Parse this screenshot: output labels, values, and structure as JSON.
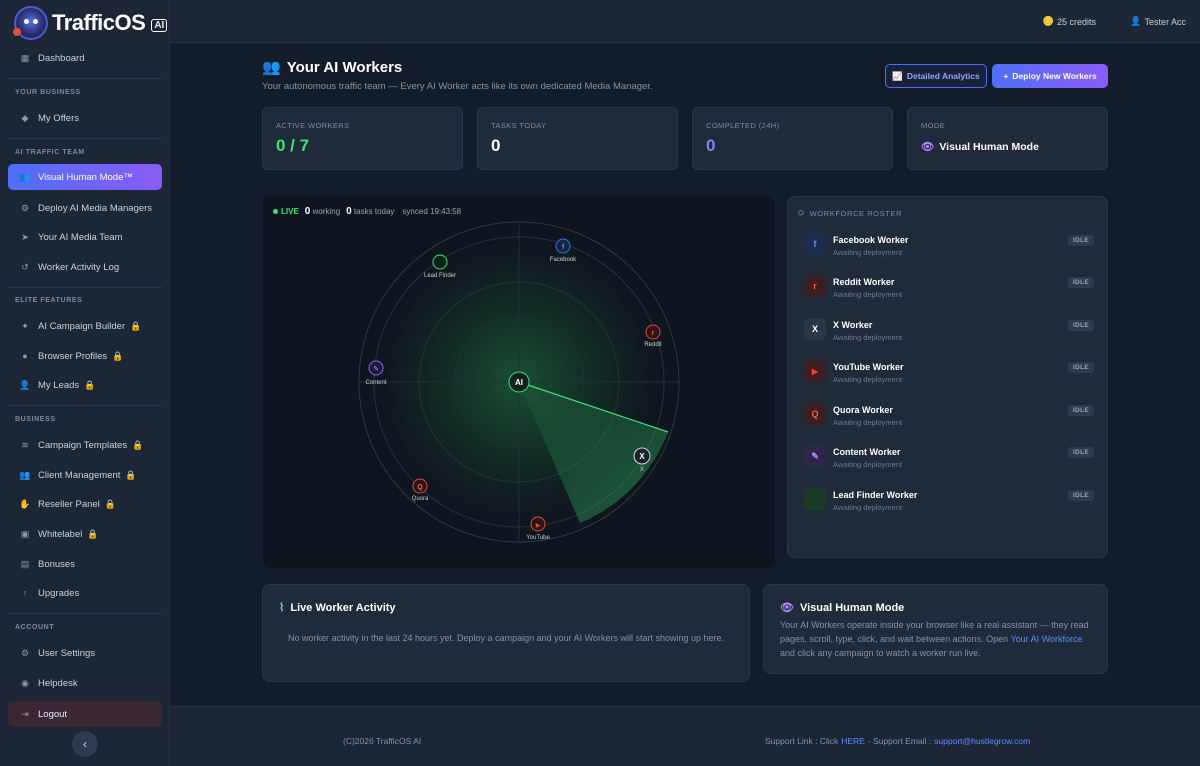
{
  "brand": {
    "name": "TrafficOS",
    "badge": "AI"
  },
  "topbar": {
    "credits": "25 credits",
    "user": "Tester Acc"
  },
  "sidebar": {
    "dashboard": "Dashboard",
    "sec_business": "YOUR BUSINESS",
    "my_offers": "My Offers",
    "sec_traffic": "AI TRAFFIC TEAM",
    "visual_human": "Visual Human Mode™",
    "deploy_managers": "Deploy AI Media Managers",
    "media_team": "Your AI Media Team",
    "activity_log": "Worker Activity Log",
    "sec_elite": "ELITE FEATURES",
    "campaign_builder": "AI Campaign Builder",
    "browser_profiles": "Browser Profiles",
    "my_leads": "My Leads",
    "sec_biz": "BUSINESS",
    "campaign_templates": "Campaign Templates",
    "client_mgmt": "Client Management",
    "reseller": "Reseller Panel",
    "whitelabel": "Whitelabel",
    "bonuses": "Bonuses",
    "upgrades": "Upgrades",
    "sec_account": "ACCOUNT",
    "user_settings": "User Settings",
    "helpdesk": "Helpdesk",
    "logout": "Logout"
  },
  "header": {
    "title": "Your AI Workers",
    "subtitle": "Your autonomous traffic team — Every AI Worker acts like its own dedicated Media Manager.",
    "analytics_btn": "Detailed Analytics",
    "deploy_btn": "Deploy New Workers"
  },
  "stats": [
    {
      "label": "ACTIVE WORKERS",
      "value": "0 / 7",
      "color": "#3ee07a"
    },
    {
      "label": "TASKS TODAY",
      "value": "0",
      "color": "#ffffff"
    },
    {
      "label": "COMPLETED (24H)",
      "value": "0",
      "color": "#8a7cf6"
    },
    {
      "label": "MODE",
      "value": "Visual Human Mode",
      "color": "#ffffff"
    }
  ],
  "radar": {
    "live": "LIVE",
    "working_count": "0",
    "working_label": "working",
    "tasks_count": "0",
    "tasks_label": "tasks today",
    "synced": "synced 19:43:58",
    "center": "AI",
    "nodes": {
      "facebook": "Facebook",
      "lead_finder": "Lead Finder",
      "reddit": "Reddit",
      "content": "Content",
      "x": "X",
      "quora": "Quora",
      "youtube": "YouTube"
    },
    "glyphs": {
      "facebook": "f",
      "reddit": "r",
      "x": "X",
      "quora": "Q",
      "youtube": "▶",
      "content": "✎"
    }
  },
  "roster": {
    "title": "WORKFORCE ROSTER",
    "workers": [
      {
        "name": "Facebook Worker",
        "status": "Awaiting deployment",
        "badge": "IDLE",
        "glyph": "f"
      },
      {
        "name": "Reddit Worker",
        "status": "Awaiting deployment",
        "badge": "IDLE",
        "glyph": "r"
      },
      {
        "name": "X Worker",
        "status": "Awaiting deployment",
        "badge": "IDLE",
        "glyph": "X"
      },
      {
        "name": "YouTube Worker",
        "status": "Awaiting deployment",
        "badge": "IDLE",
        "glyph": "▶"
      },
      {
        "name": "Quora Worker",
        "status": "Awaiting deployment",
        "badge": "IDLE",
        "glyph": "Q"
      },
      {
        "name": "Content Worker",
        "status": "Awaiting deployment",
        "badge": "IDLE",
        "glyph": "✎"
      },
      {
        "name": "Lead Finder Worker",
        "status": "Awaiting deployment",
        "badge": "IDLE",
        "glyph": ""
      }
    ]
  },
  "activity": {
    "title": "Live Worker Activity",
    "empty": "No worker activity in the last 24 hours yet. Deploy a campaign and your AI Workers will start showing up here."
  },
  "vhm": {
    "title": "Visual Human Mode",
    "body_pre": "Your AI Workers operate inside your browser like a real assistant — they read pages, scroll, type, click, and wait between actions. Open ",
    "link": "Your AI Workforce",
    "body_post": " and click any campaign to watch a worker run live."
  },
  "footer": {
    "copyright": "(C)2026 TrafficOS AI",
    "support_pre": "Support Link : Click",
    "here": "HERE",
    "support_mid": "- Support Email :",
    "email": "support@hustlegrow.com"
  }
}
